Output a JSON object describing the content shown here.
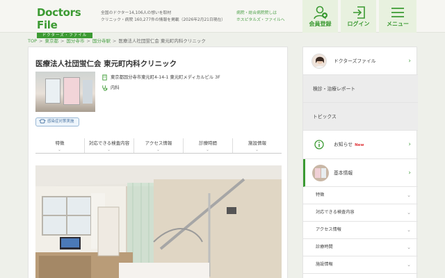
{
  "header": {
    "logo_main": "Doctors File",
    "logo_sub": "ドクターズ・ファイル",
    "tagline_1": "全国のドクター14,106人の想いを取材",
    "tagline_2": "クリニック・病院 160,277件の情報を掲載（2026年2月21日現在）",
    "hospital_link_1": "病院・総合病院院しは",
    "hospital_link_2": "ホスピタルズ・ファイルへ",
    "register_label": "会員登録",
    "login_label": "ログイン",
    "menu_label": "メニュー",
    "accent": "#3b9a32"
  },
  "breadcrumb": [
    "TOP",
    "東京都",
    "国分寺市",
    "国分寺駅",
    "医療法人社団蛍仁会 東元町内科クリニック"
  ],
  "clinic": {
    "title": "医療法人社団蛍仁会 東元町内科クリニック",
    "address": "東京都国分寺市東元町4-14-1 東元町メディカルビル 3F",
    "department": "内科",
    "badge": "感染症対策実施"
  },
  "tabs": [
    "特徴",
    "対応できる検査内容",
    "アクセス情報",
    "診療時間",
    "施設情報"
  ],
  "sidebar": {
    "items": [
      {
        "label": "ドクターズファイル",
        "icon": "doctor-avatar"
      },
      {
        "label": "検診・治療レポート"
      },
      {
        "label": "トピックス"
      },
      {
        "label": "お知らせ",
        "new": "New",
        "icon": "info-icon"
      },
      {
        "label": "基本情報",
        "icon": "clinic-thumb"
      }
    ],
    "sub_items": [
      "特徴",
      "対応できる検査内容",
      "アクセス情報",
      "診療時間",
      "施設情報"
    ]
  }
}
